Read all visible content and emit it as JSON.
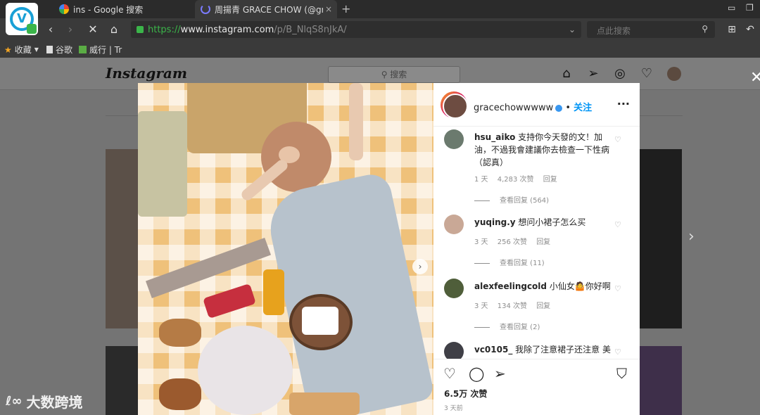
{
  "browser": {
    "tabs": [
      {
        "label": "ins - Google 搜索",
        "close": ""
      },
      {
        "label": "周揚青 GRACE CHOW (@grac",
        "close": "×"
      }
    ],
    "new_tab": "+",
    "window_controls": [
      "▭",
      "❐"
    ],
    "nav": {
      "back": "‹",
      "forward": "›",
      "stop": "✕",
      "home": "⌂"
    },
    "url": {
      "scheme": "https://",
      "host": "www.instagram.com",
      "path": "/p/B_NlqS8nJkA/"
    },
    "search_placeholder": "点此搜索",
    "bookmarks": [
      {
        "label": "收藏",
        "icon": "star-icon"
      },
      {
        "label": "谷歌",
        "icon": "page-icon"
      },
      {
        "label": "威行 | Tr",
        "icon": "board-icon"
      }
    ]
  },
  "instagram": {
    "logo": "Instagram",
    "search_placeholder": "搜索",
    "nav_icons": [
      "home-icon",
      "send-icon",
      "explore-icon",
      "heart-icon",
      "profile-icon"
    ]
  },
  "post": {
    "username": "gracechowwwww",
    "separator": "•",
    "follow_label": "关注",
    "comments": [
      {
        "user": "hsu_aiko",
        "text": "支持你今天發的文！加油，不過我會建議你去檢查一下性病（認真）",
        "time": "1 天",
        "likes": "4,283 次赞",
        "reply": "回复",
        "view_replies": "查看回复 (564)"
      },
      {
        "user": "yuqing.y",
        "text": "想问小裙子怎么买",
        "time": "3 天",
        "likes": "256 次赞",
        "reply": "回复",
        "view_replies": "查看回复 (11)"
      },
      {
        "user": "alexfeelingcold",
        "text": "小仙女🤷你好啊",
        "time": "3 天",
        "likes": "134 次赞",
        "reply": "回复",
        "view_replies": "查看回复 (2)"
      },
      {
        "user": "vc0105_",
        "text": "我除了注意裙子还注意 美",
        "time": "",
        "likes": "",
        "reply": "",
        "view_replies": ""
      }
    ],
    "likes": "6.5万 次赞",
    "time": "3 天前"
  },
  "watermark": {
    "logo": "ℓ∞",
    "text": "大数跨境"
  },
  "colors": {
    "follow": "#0095f6",
    "url_green": "#3bb54a"
  }
}
